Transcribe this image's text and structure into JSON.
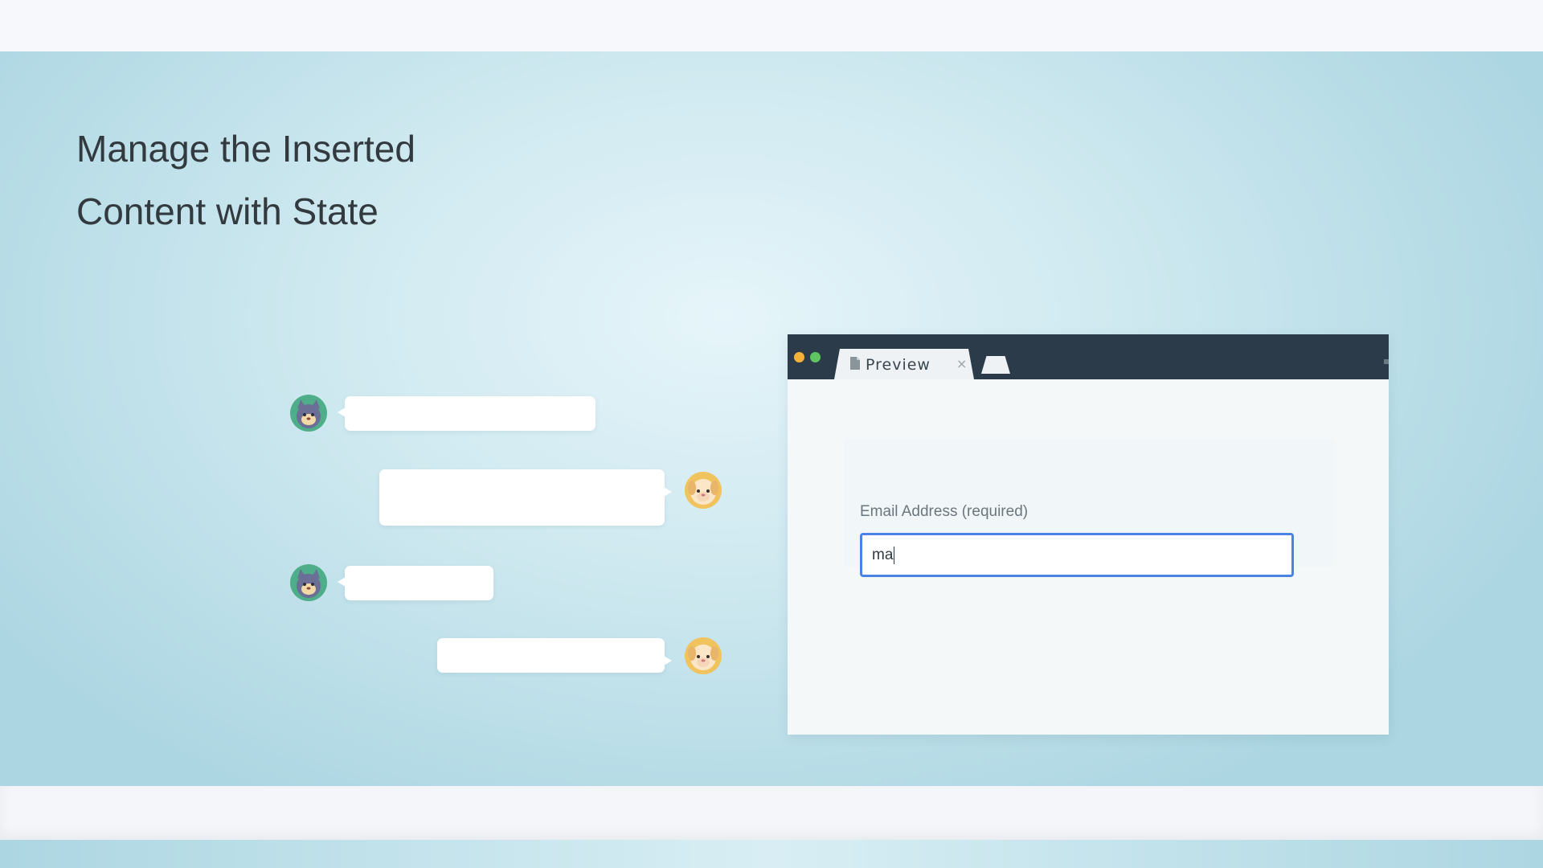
{
  "headline": {
    "line1": "Manage the Inserted",
    "line2": "Content with State"
  },
  "chat": {
    "messages": [
      {
        "sender": "cat",
        "side": "left"
      },
      {
        "sender": "dog",
        "side": "right"
      },
      {
        "sender": "cat",
        "side": "left"
      },
      {
        "sender": "dog",
        "side": "right"
      }
    ]
  },
  "browser": {
    "tab_label": "Preview",
    "tab_close": "×",
    "tab_icon": "document-icon",
    "email_label": "Email Address (required)",
    "email_value": "ma"
  },
  "colors": {
    "titlebar": "#2b3b4a",
    "input_border": "#4a82e6",
    "dot_yellow": "#f5b23a",
    "dot_green": "#5fc560"
  }
}
